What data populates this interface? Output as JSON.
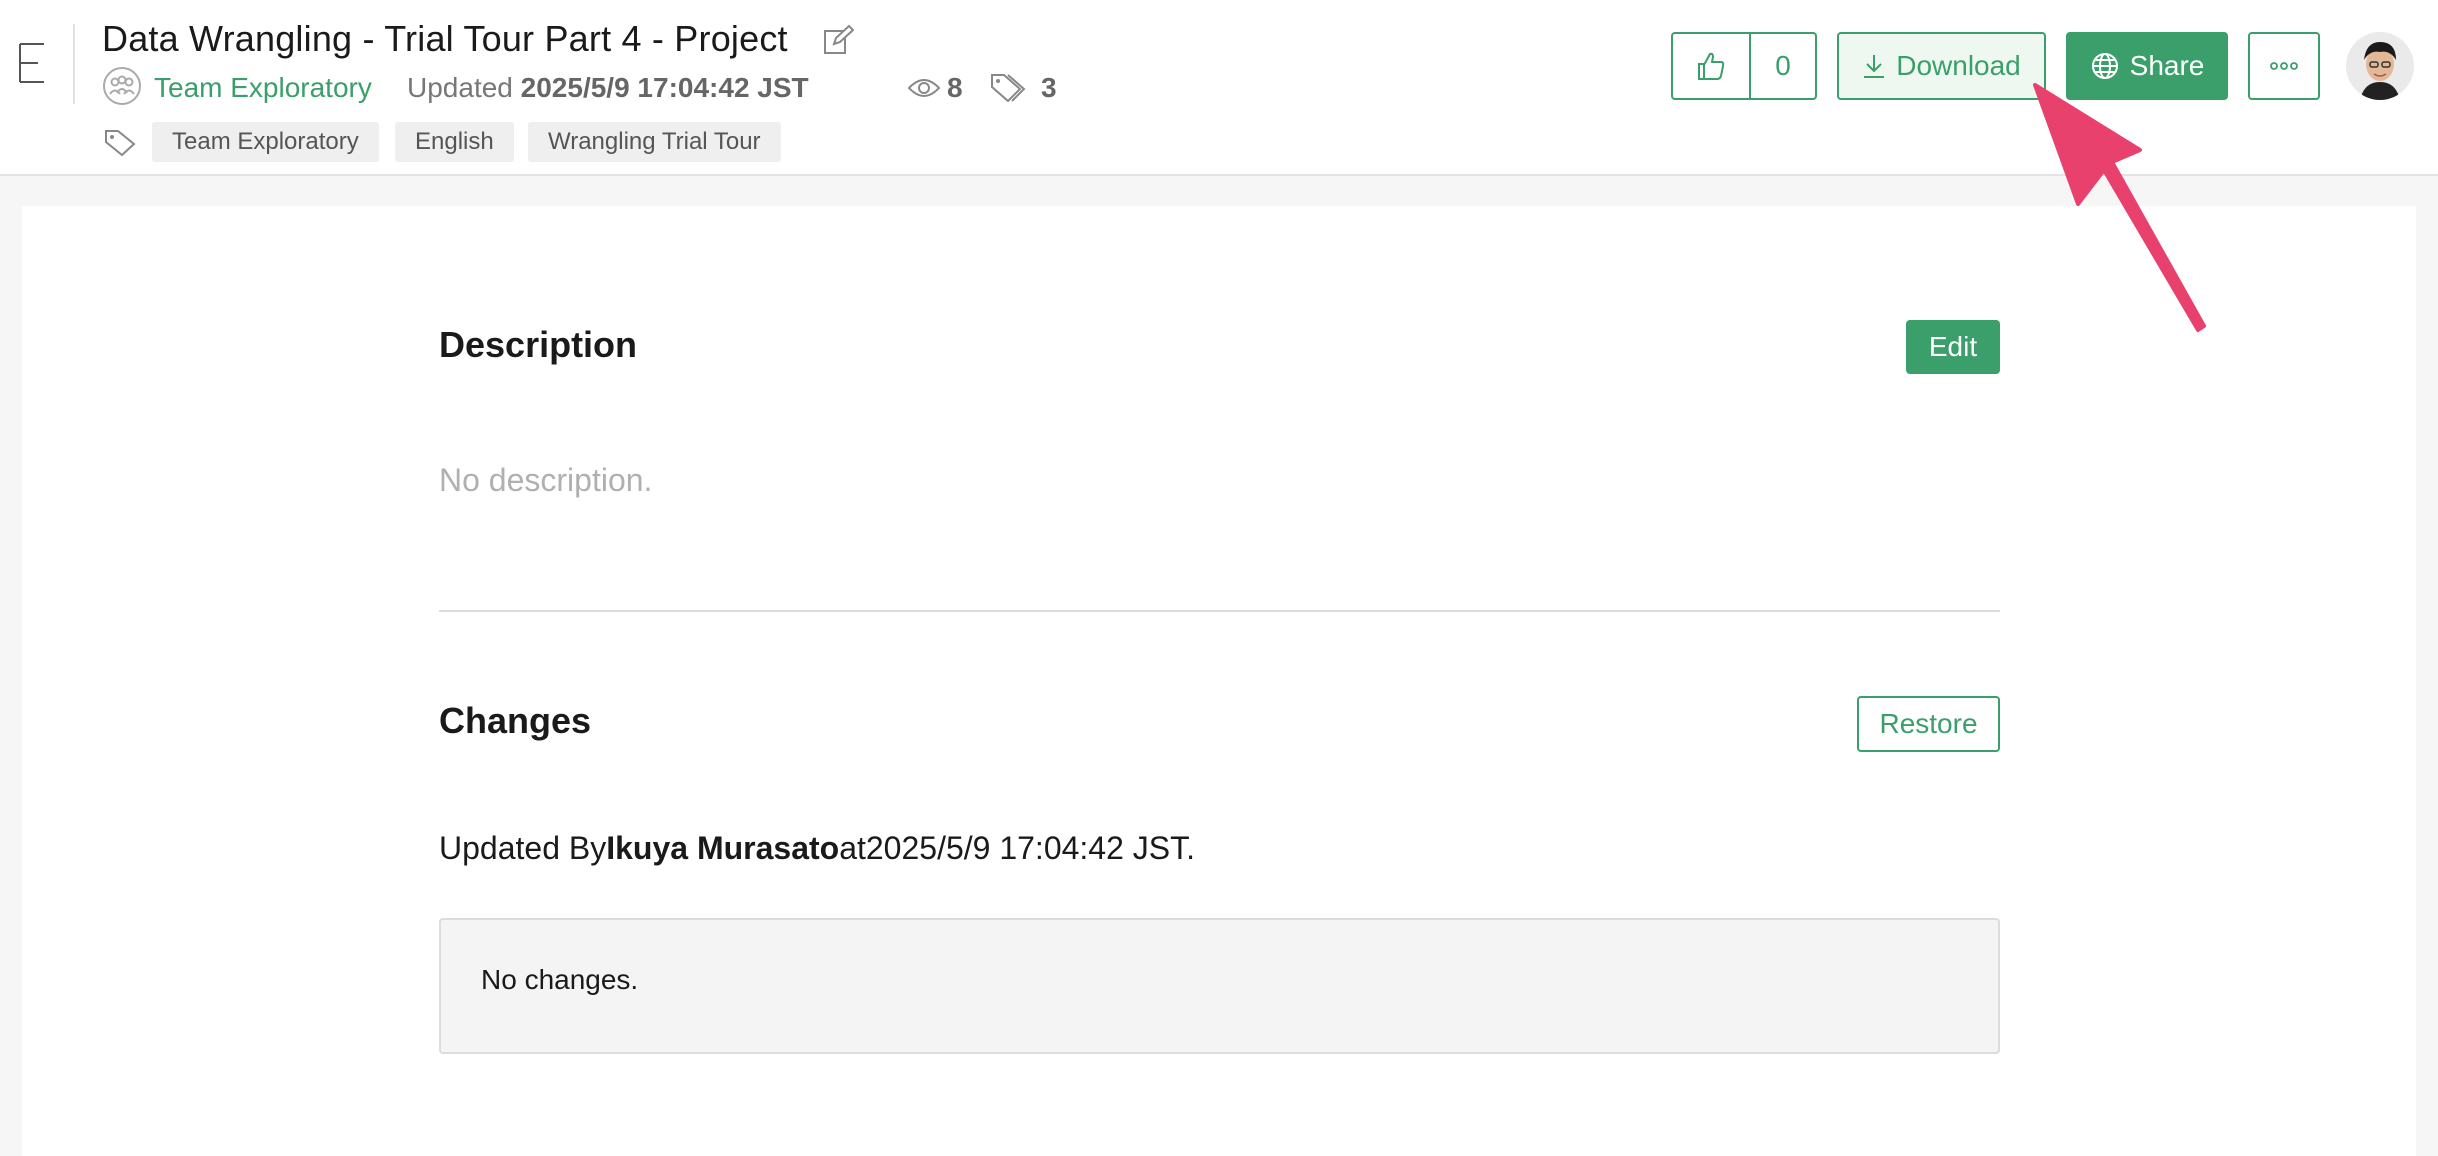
{
  "header": {
    "title": "Data Wrangling - Trial Tour Part 4 - Project",
    "team": "Team Exploratory",
    "updated_label": "Updated",
    "updated_time": "2025/5/9 17:04:42 JST",
    "views": "8",
    "tag_count": "3",
    "tags": [
      "Team Exploratory",
      "English",
      "Wrangling Trial Tour"
    ],
    "like_count": "0",
    "download_label": "Download",
    "share_label": "Share"
  },
  "description": {
    "title": "Description",
    "edit_label": "Edit",
    "empty_text": "No description."
  },
  "changes": {
    "title": "Changes",
    "restore_label": "Restore",
    "updated_by_prefix": "Updated By",
    "updated_by_user": "Ikuya Murasato",
    "updated_by_mid": "at",
    "updated_by_time": "2025/5/9 17:04:42 JST.",
    "no_changes_text": "No changes."
  },
  "colors": {
    "accent": "#3a9f6a",
    "annotation": "#e8416e"
  }
}
